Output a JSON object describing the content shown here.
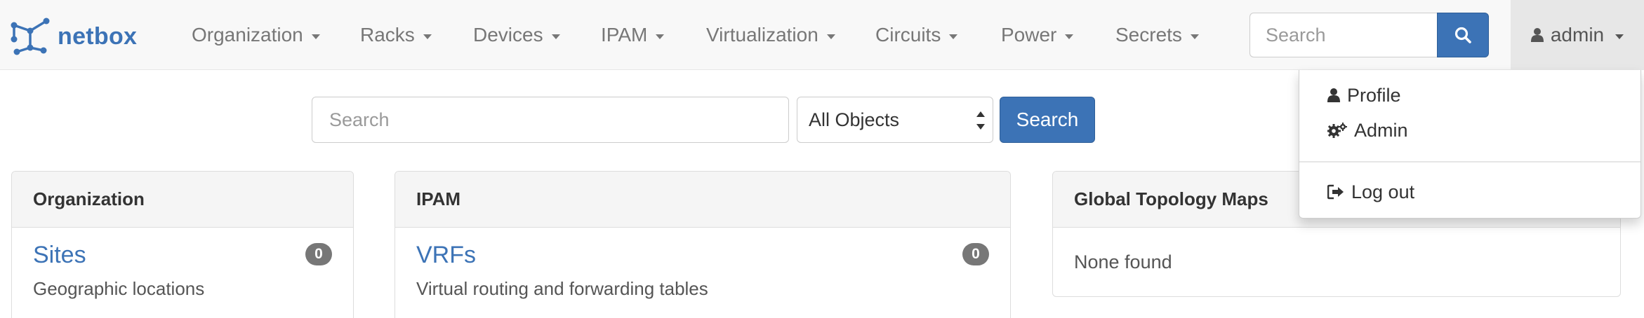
{
  "brand": {
    "name": "netbox"
  },
  "nav": {
    "items": [
      {
        "label": "Organization"
      },
      {
        "label": "Racks"
      },
      {
        "label": "Devices"
      },
      {
        "label": "IPAM"
      },
      {
        "label": "Virtualization"
      },
      {
        "label": "Circuits"
      },
      {
        "label": "Power"
      },
      {
        "label": "Secrets"
      }
    ],
    "search_placeholder": "Search",
    "user": "admin"
  },
  "user_dropdown": {
    "items": [
      {
        "label": "Profile",
        "icon": "user-icon"
      },
      {
        "label": "Admin",
        "icon": "gears-icon"
      },
      {
        "label": "Log out",
        "icon": "sign-out-icon"
      }
    ]
  },
  "search": {
    "placeholder": "Search",
    "scope": "All Objects",
    "button": "Search"
  },
  "panels": [
    {
      "heading": "Organization",
      "entries": [
        {
          "title": "Sites",
          "count": "0",
          "description": "Geographic locations"
        }
      ]
    },
    {
      "heading": "IPAM",
      "entries": [
        {
          "title": "VRFs",
          "count": "0",
          "description": "Virtual routing and forwarding tables"
        }
      ]
    },
    {
      "heading": "Global Topology Maps",
      "empty_text": "None found"
    }
  ],
  "colors": {
    "brand": "#3c73b6",
    "navbar_bg": "#f8f8f8",
    "badge": "#777777",
    "text": "#333333"
  }
}
